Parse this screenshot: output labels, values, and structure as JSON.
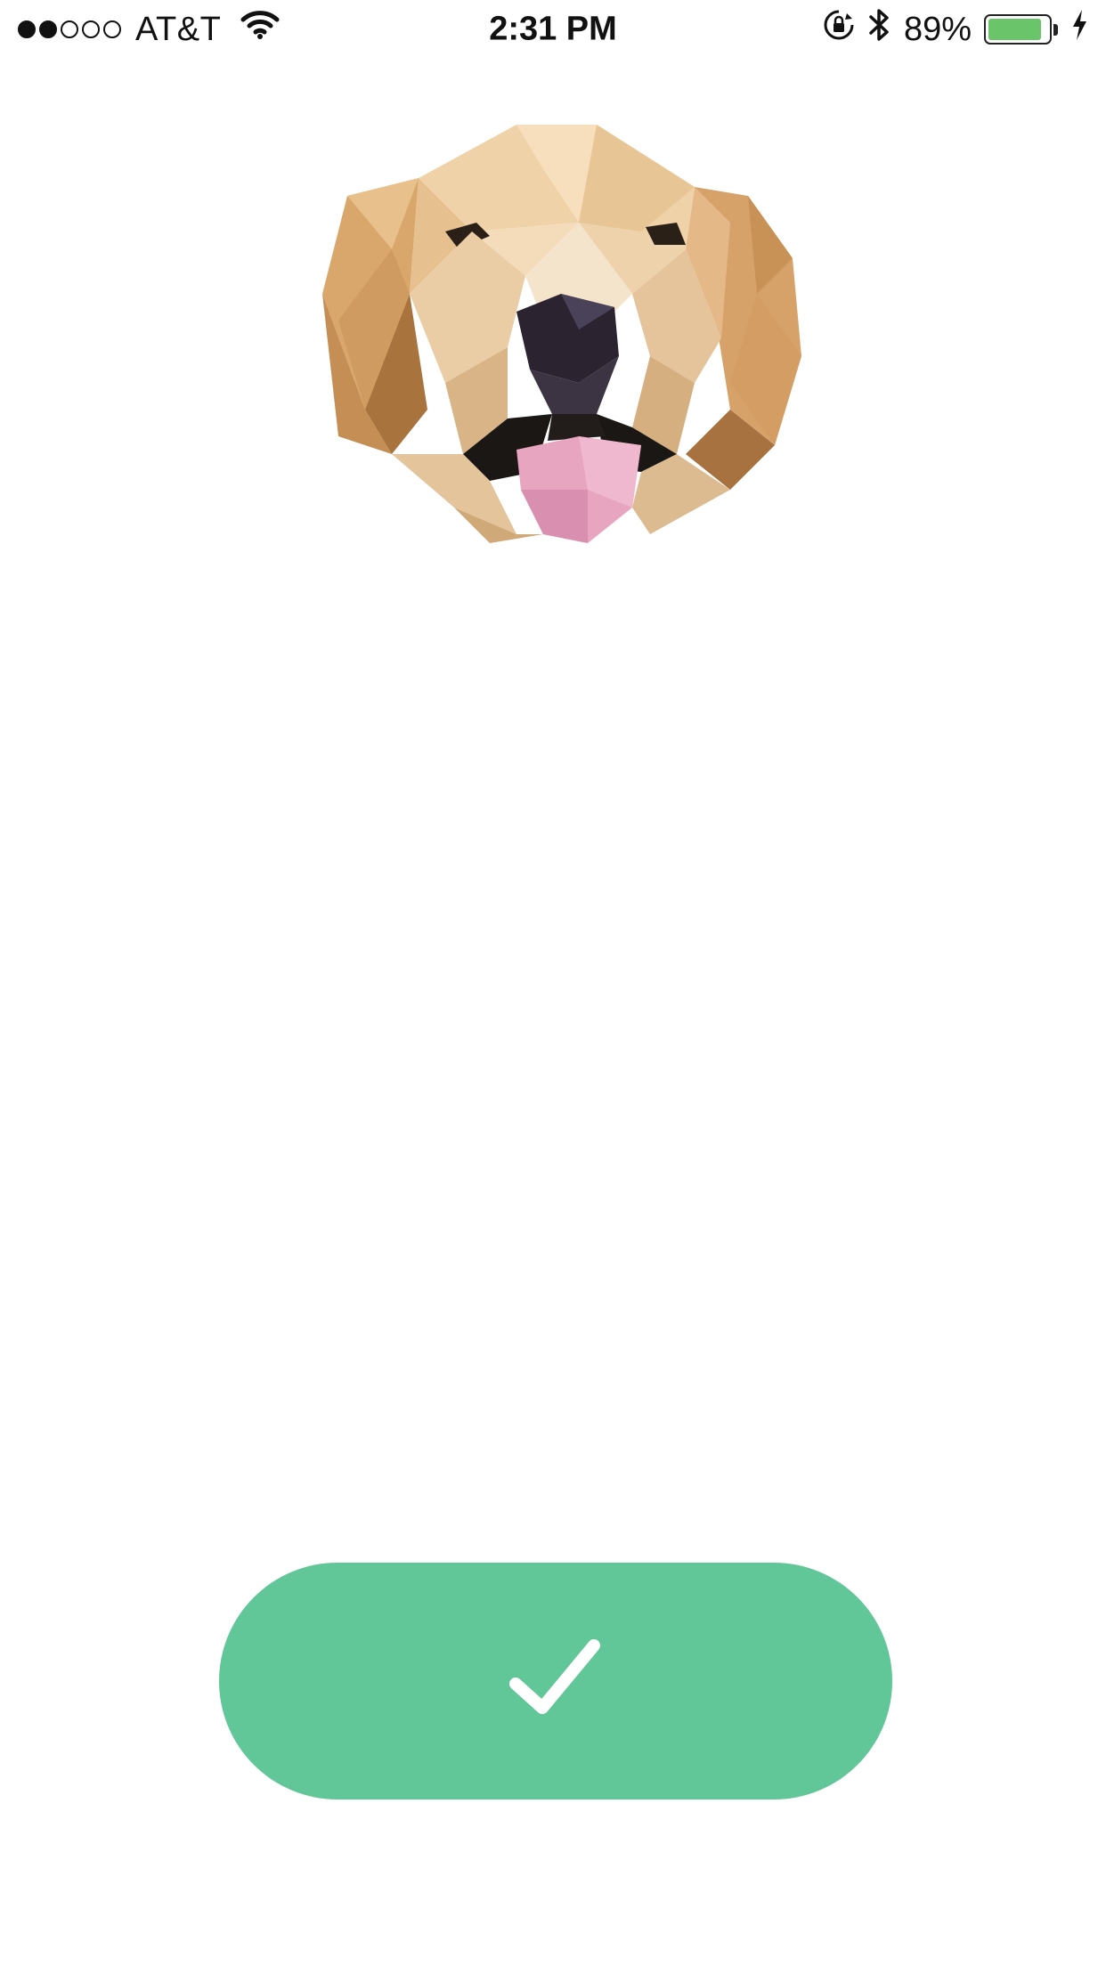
{
  "status_bar": {
    "signal_strength": 2,
    "signal_max": 5,
    "carrier": "AT&T",
    "time": "2:31 PM",
    "battery_percent": "89%",
    "battery_level": 0.89,
    "icons": [
      "wifi-icon",
      "orientation-lock-icon",
      "bluetooth-icon",
      "battery-icon",
      "charging-bolt-icon"
    ]
  },
  "illustration": {
    "subject": "low-poly golden retriever head",
    "icon": "dog-illustration"
  },
  "confirm_button": {
    "icon": "checkmark-icon",
    "color": "#62c798"
  },
  "colors": {
    "background": "#ffffff",
    "accent_green": "#62c798",
    "battery_green": "#69c46a"
  }
}
